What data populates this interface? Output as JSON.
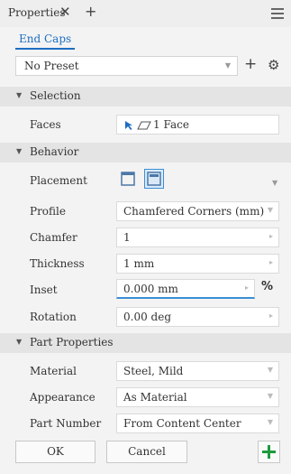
{
  "header": {
    "title": "Properties"
  },
  "tab": {
    "label": "End Caps"
  },
  "preset": {
    "value": "No Preset"
  },
  "selection": {
    "heading": "Selection",
    "faces_label": "Faces",
    "faces_value": "1 Face"
  },
  "behavior": {
    "heading": "Behavior",
    "placement_label": "Placement",
    "profile_label": "Profile",
    "profile_value": "Chamfered Corners (mm)",
    "chamfer_label": "Chamfer",
    "chamfer_value": "1",
    "thickness_label": "Thickness",
    "thickness_value": "1 mm",
    "inset_label": "Inset",
    "inset_value": "0.000 mm",
    "inset_unit": "%",
    "rotation_label": "Rotation",
    "rotation_value": "0.00 deg"
  },
  "part_properties": {
    "heading": "Part Properties",
    "material_label": "Material",
    "material_value": "Steel, Mild",
    "appearance_label": "Appearance",
    "appearance_value": "As Material",
    "part_number_label": "Part Number",
    "part_number_value": "From Content Center"
  },
  "footer": {
    "ok_label": "OK",
    "cancel_label": "Cancel"
  },
  "colors": {
    "accent": "#1d6ec2",
    "add_green": "#1f9a3c"
  }
}
